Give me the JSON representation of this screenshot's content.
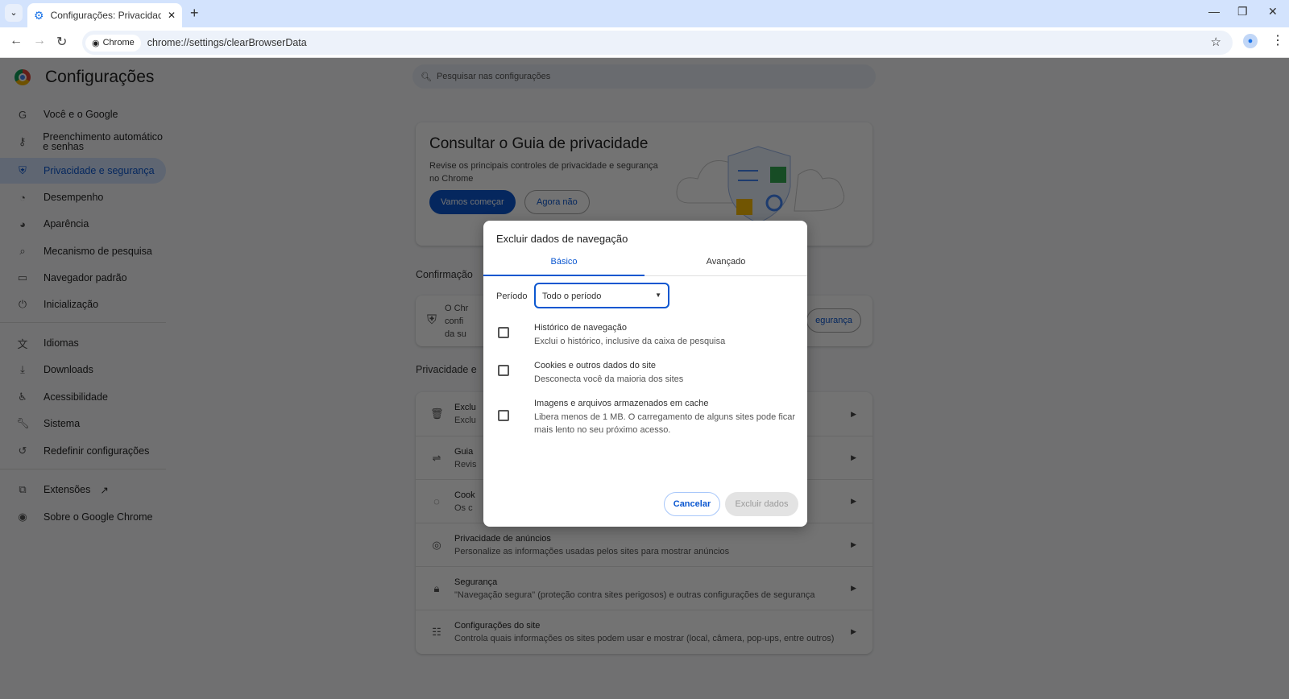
{
  "browser": {
    "tab_title": "Configurações: Privacidade e se",
    "chip_label": "Chrome",
    "url": "chrome://settings/clearBrowserData"
  },
  "settings": {
    "title": "Configurações",
    "search_placeholder": "Pesquisar nas configurações",
    "sidebar": [
      {
        "label": "Você e o Google",
        "icon": "google-icon"
      },
      {
        "label": "Preenchimento automático e senhas",
        "icon": "key-icon"
      },
      {
        "label": "Privacidade e segurança",
        "icon": "shield-icon",
        "active": true
      },
      {
        "label": "Desempenho",
        "icon": "speedometer-icon"
      },
      {
        "label": "Aparência",
        "icon": "palette-icon"
      },
      {
        "label": "Mecanismo de pesquisa",
        "icon": "search-icon"
      },
      {
        "label": "Navegador padrão",
        "icon": "browser-icon"
      },
      {
        "label": "Inicialização",
        "icon": "power-icon"
      },
      {
        "label": "Idiomas",
        "icon": "translate-icon"
      },
      {
        "label": "Downloads",
        "icon": "download-icon"
      },
      {
        "label": "Acessibilidade",
        "icon": "accessibility-icon"
      },
      {
        "label": "Sistema",
        "icon": "wrench-icon"
      },
      {
        "label": "Redefinir configurações",
        "icon": "reset-icon"
      },
      {
        "label": "Extensões",
        "icon": "puzzle-icon"
      },
      {
        "label": "Sobre o Google Chrome",
        "icon": "chrome-icon"
      }
    ],
    "guide": {
      "title": "Consultar o Guia de privacidade",
      "desc": "Revise os principais controles de privacidade e segurança no Chrome",
      "start": "Vamos começar",
      "dismiss": "Agora não"
    },
    "confirm_label": "Confirmação",
    "confirm_text": [
      "O Chr",
      "confi",
      "da su"
    ],
    "confirm_button": "egurança",
    "privacy_label": "Privacidade e",
    "rows": [
      {
        "title": "Exclu",
        "desc": "Exclu",
        "icon": "trash-icon"
      },
      {
        "title": "Guia",
        "desc": "Revis",
        "icon": "signpost-icon"
      },
      {
        "title": "Cook",
        "desc": "Os c",
        "icon": "cookie-icon"
      },
      {
        "title": "Privacidade de anúncios",
        "desc": "Personalize as informações usadas pelos sites para mostrar anúncios",
        "icon": "ads-icon"
      },
      {
        "title": "Segurança",
        "desc": "\"Navegação segura\" (proteção contra sites perigosos) e outras configurações de segurança",
        "icon": "lock-icon"
      },
      {
        "title": "Configurações do site",
        "desc": "Controla quais informações os sites podem usar e mostrar (local, câmera, pop-ups, entre outros)",
        "icon": "sliders-icon"
      }
    ]
  },
  "dialog": {
    "title": "Excluir dados de navegação",
    "tabs": [
      "Básico",
      "Avançado"
    ],
    "period_label": "Período",
    "period_value": "Todo o período",
    "options": [
      {
        "title": "Histórico de navegação",
        "desc": "Exclui o histórico, inclusive da caixa de pesquisa",
        "checked": false
      },
      {
        "title": "Cookies e outros dados do site",
        "desc": "Desconecta você da maioria dos sites",
        "checked": false
      },
      {
        "title": "Imagens e arquivos armazenados em cache",
        "desc": "Libera menos de 1 MB. O carregamento de alguns sites pode ficar mais lento no seu próximo acesso.",
        "checked": false
      }
    ],
    "cancel": "Cancelar",
    "confirm": "Excluir dados"
  },
  "colors": {
    "accent": "#0b57d0",
    "tabbar": "#d3e3fd"
  }
}
